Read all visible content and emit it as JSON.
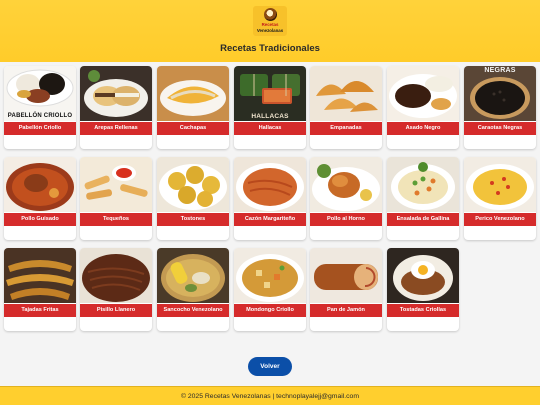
{
  "header": {
    "logo_line1": "Recetas",
    "logo_line2": "Venezolanas",
    "title": "Recetas Tradicionales"
  },
  "recipes": [
    {
      "label": "Pabellón Criollo",
      "image_caption": "PABELLÓN CRIOLLO",
      "icon": "pabellon-dish"
    },
    {
      "label": "Arepas Rellenas",
      "icon": "arepas-dish"
    },
    {
      "label": "Cachapas",
      "icon": "cachapas-dish"
    },
    {
      "label": "Hallacas",
      "image_caption": "HALLACAS",
      "icon": "hallacas-dish"
    },
    {
      "label": "Empanadas",
      "icon": "empanadas-dish"
    },
    {
      "label": "Asado Negro",
      "icon": "asado-negro-dish"
    },
    {
      "label": "Caraotas Negras",
      "image_caption": "NEGRAS",
      "icon": "caraotas-dish"
    },
    {
      "label": "Pollo Guisado",
      "icon": "pollo-guisado-dish"
    },
    {
      "label": "Tequeños",
      "icon": "tequenos-dish"
    },
    {
      "label": "Tostones",
      "icon": "tostones-dish"
    },
    {
      "label": "Cazón Margariteño",
      "icon": "cazon-dish"
    },
    {
      "label": "Pollo al Horno",
      "icon": "pollo-horno-dish"
    },
    {
      "label": "Ensalada de Gallina",
      "icon": "ensalada-dish"
    },
    {
      "label": "Perico Venezolano",
      "icon": "perico-dish"
    },
    {
      "label": "Tajadas Fritas",
      "icon": "tajadas-dish"
    },
    {
      "label": "Pisillo Llanero",
      "icon": "pisillo-dish"
    },
    {
      "label": "Sancocho Venezolano",
      "icon": "sancocho-dish"
    },
    {
      "label": "Mondongo Criollo",
      "icon": "mondongo-dish"
    },
    {
      "label": "Pan de Jamón",
      "icon": "pan-jamon-dish"
    },
    {
      "label": "Tostadas Criollas",
      "icon": "tostadas-dish"
    }
  ],
  "actions": {
    "back_label": "Volver"
  },
  "footer": {
    "text": "© 2025 Recetas Venezolanas | technoplayalejj@gmail.com"
  },
  "colors": {
    "header_bg": "#ffcc2a",
    "label_bg": "#d52b2b",
    "button_bg": "#0b4fa8",
    "footer_bg": "#ffcf2e"
  }
}
